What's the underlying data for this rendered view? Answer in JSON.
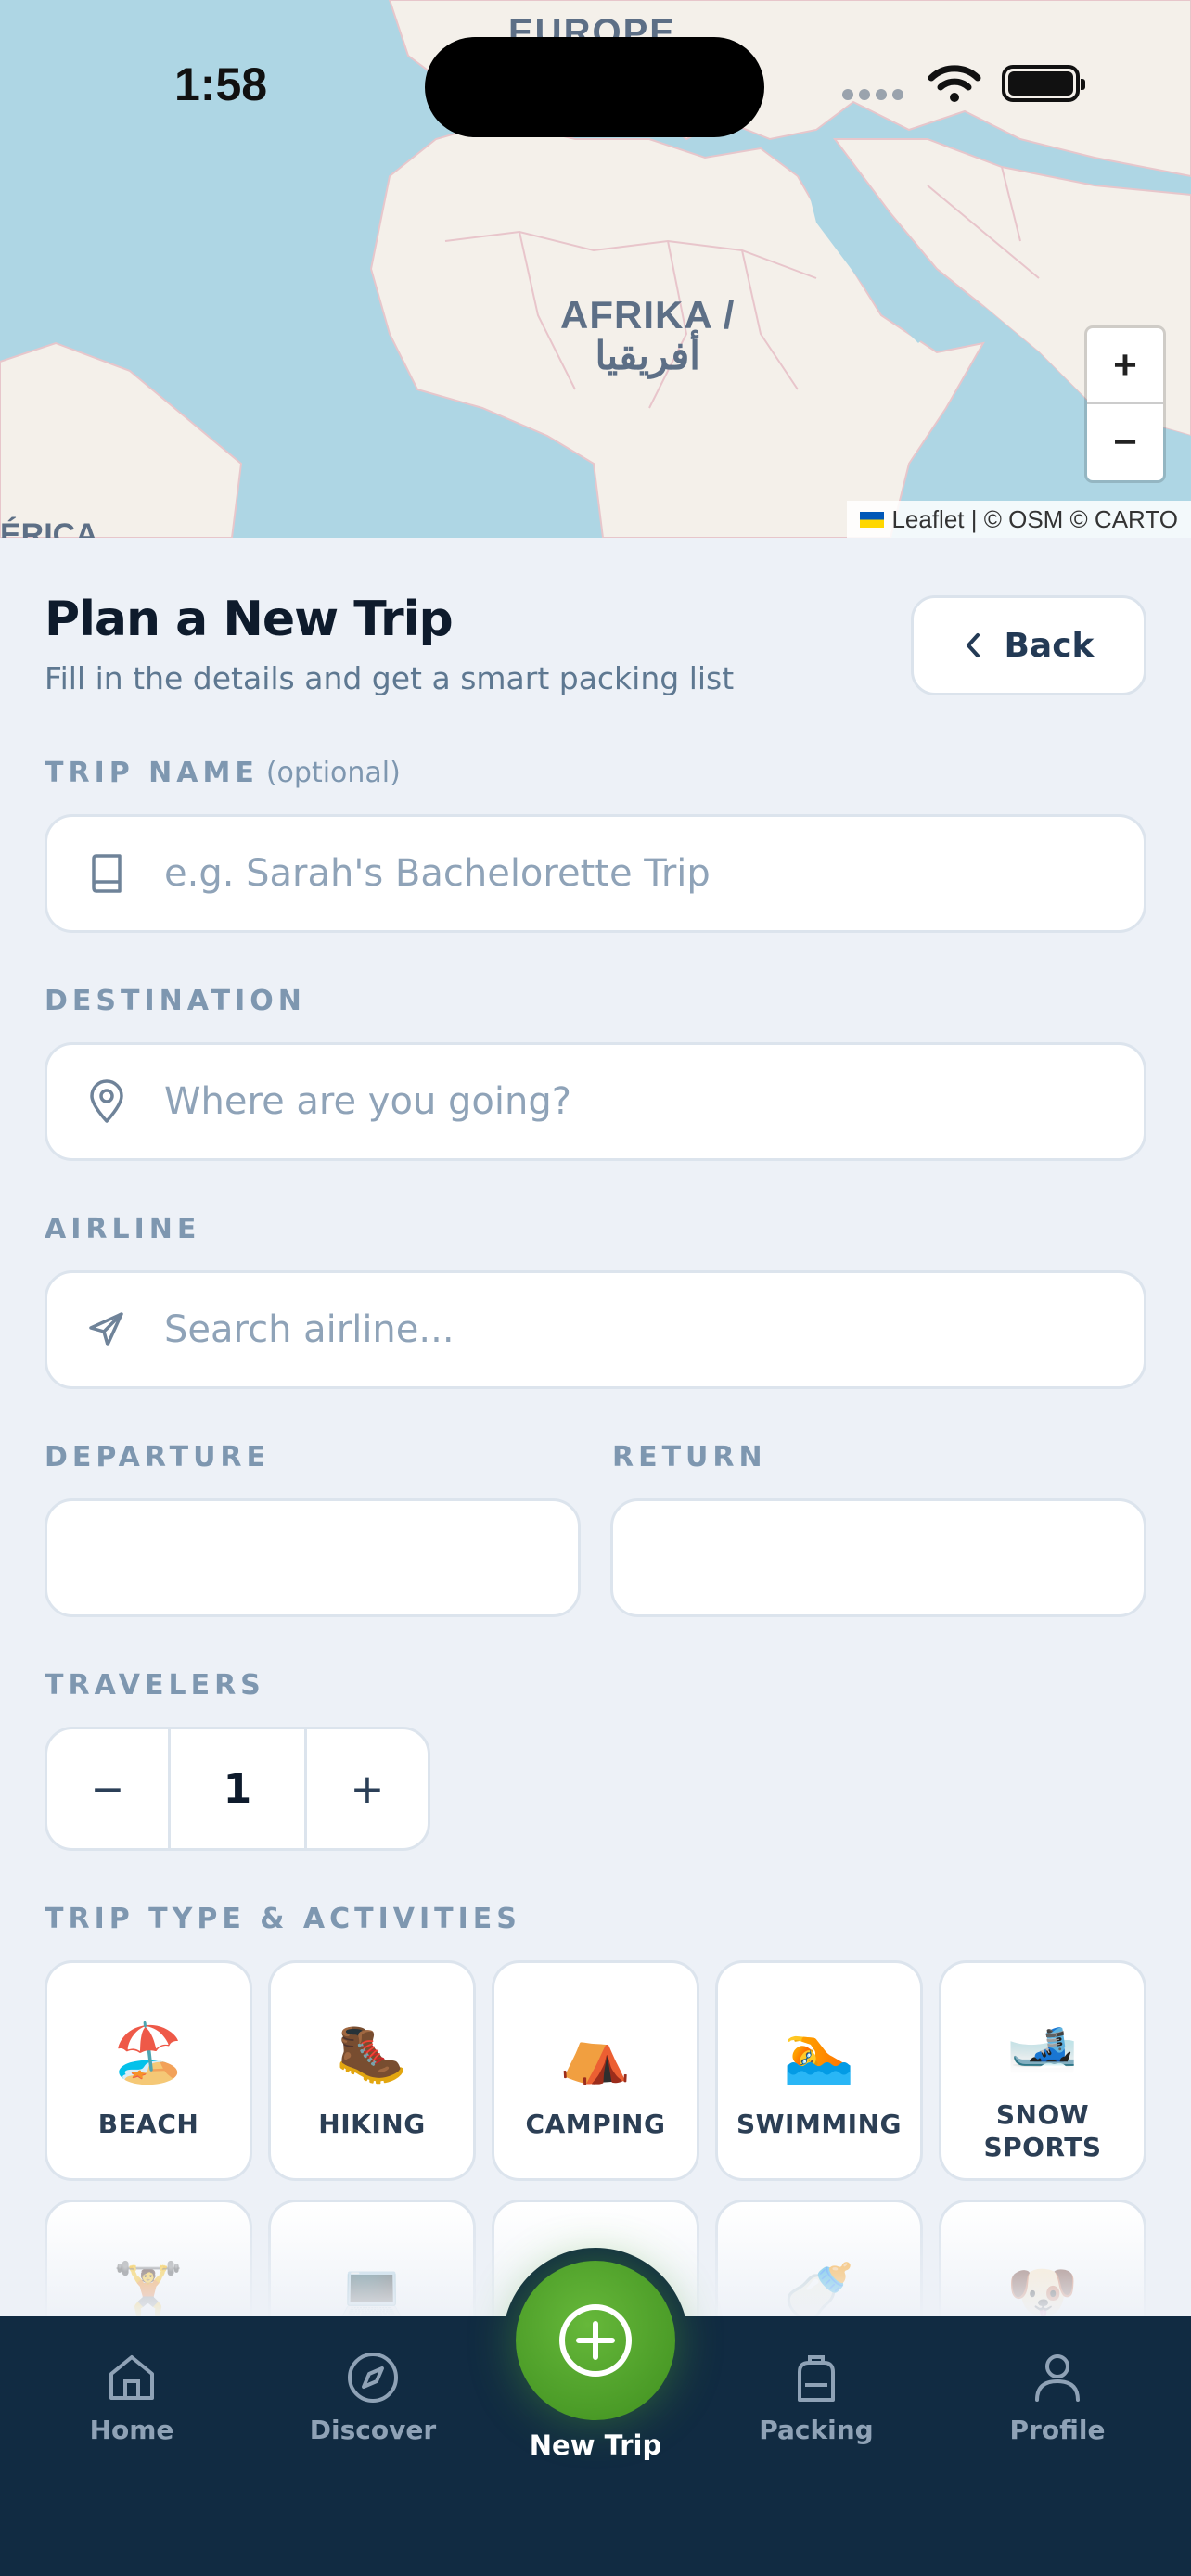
{
  "status_bar": {
    "time": "1:58"
  },
  "map": {
    "label_europe": "EUROPE",
    "label_africa_line1": "AFRIKA /",
    "label_africa_line2": "أفريقيا",
    "label_america": "ÉRICA",
    "zoom_in": "+",
    "zoom_out": "−",
    "attribution": "Leaflet | © OSM © CARTO"
  },
  "header": {
    "title": "Plan a New Trip",
    "subtitle": "Fill in the details and get a smart packing list",
    "back_label": "Back"
  },
  "form": {
    "trip_name": {
      "label": "TRIP NAME",
      "optional": "(optional)",
      "placeholder": "e.g. Sarah's Bachelorette Trip",
      "icon": "book-icon"
    },
    "destination": {
      "label": "DESTINATION",
      "placeholder": "Where are you going?",
      "icon": "map-pin-icon"
    },
    "airline": {
      "label": "AIRLINE",
      "placeholder": "Search airline...",
      "icon": "plane-icon"
    },
    "departure": {
      "label": "DEPARTURE"
    },
    "return": {
      "label": "RETURN"
    },
    "travelers": {
      "label": "TRAVELERS",
      "value": "1",
      "minus": "−",
      "plus": "+"
    },
    "activities": {
      "label": "TRIP TYPE & ACTIVITIES",
      "items": [
        {
          "label": "BEACH",
          "emoji": "🏖️"
        },
        {
          "label": "HIKING",
          "emoji": "🥾"
        },
        {
          "label": "CAMPING",
          "emoji": "⛺"
        },
        {
          "label": "SWIMMING",
          "emoji": "🏊"
        },
        {
          "label": "SNOW\nSPORTS",
          "emoji": "🎿"
        },
        {
          "label": "",
          "emoji": "🏋️"
        },
        {
          "label": "",
          "emoji": "💻"
        },
        {
          "label": "",
          "emoji": ""
        },
        {
          "label": "",
          "emoji": "🍼"
        },
        {
          "label": "",
          "emoji": "🐶"
        }
      ]
    }
  },
  "nav": {
    "items": [
      {
        "label": "Home",
        "icon": "home-icon"
      },
      {
        "label": "Discover",
        "icon": "compass-icon"
      },
      {
        "label": "New Trip",
        "icon": "plus-circle-icon"
      },
      {
        "label": "Packing",
        "icon": "backpack-icon"
      },
      {
        "label": "Profile",
        "icon": "user-icon"
      }
    ]
  },
  "colors": {
    "accent": "#4ea52a",
    "nav_bg": "#112b42",
    "page_bg": "#edf1f7"
  }
}
